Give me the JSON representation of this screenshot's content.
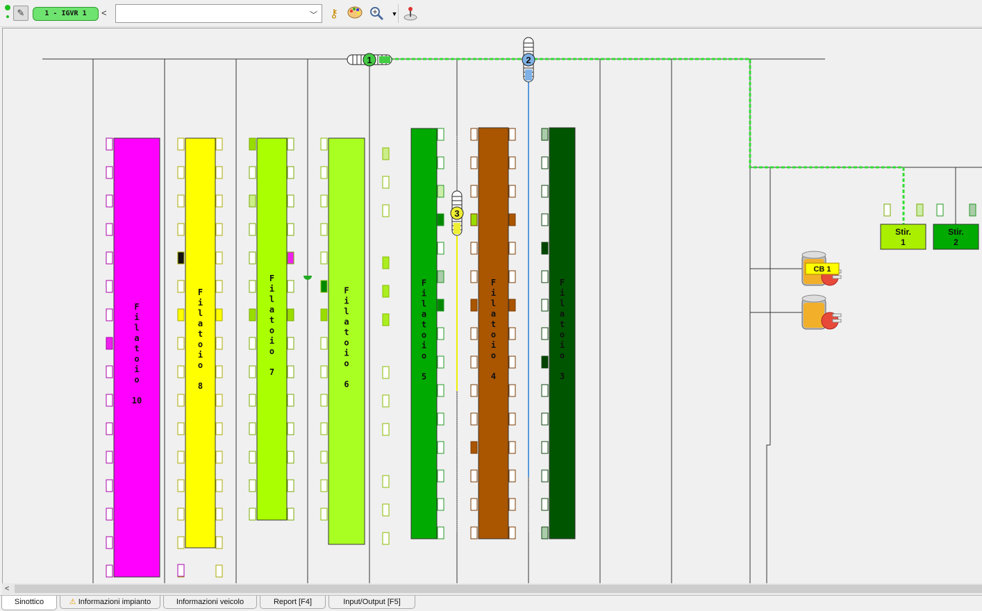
{
  "toolbar": {
    "vehicle_selector": "1 - IGVR 1",
    "prev_arrow": "<",
    "combo_value": "",
    "icons": [
      "status-led",
      "tools-icon",
      "key-icon",
      "palette-icon",
      "zoom-icon",
      "joystick-icon"
    ]
  },
  "synoptic": {
    "machines": [
      {
        "name": "Filatoio 10",
        "letters": "Filatoio",
        "number": "10",
        "color": "#ff00ff"
      },
      {
        "name": "Filatoio 8",
        "letters": "Filatoio",
        "number": "8",
        "color": "#ffff00"
      },
      {
        "name": "Filatoio 7",
        "letters": "Filatoio",
        "number": "7",
        "color": "#aaff00"
      },
      {
        "name": "Filatoio 6",
        "letters": "Filatoio",
        "number": "6",
        "color": "#aaff22"
      },
      {
        "name": "Filatoio 5",
        "letters": "Filatoio",
        "number": "5",
        "color": "#00aa00"
      },
      {
        "name": "Filatoio 4",
        "letters": "Filatoio",
        "number": "4",
        "color": "#aa5500"
      },
      {
        "name": "Filatoio 3",
        "letters": "Filatoio",
        "number": "3",
        "color": "#005500"
      }
    ],
    "stirs": [
      {
        "label": "Stir.",
        "number": "1",
        "color": "#aaee00"
      },
      {
        "label": "Stir.",
        "number": "2",
        "color": "#00aa00"
      }
    ],
    "vehicles": [
      {
        "id": "1",
        "color": "#44cc44"
      },
      {
        "id": "2",
        "color": "#7fb1e6"
      },
      {
        "id": "3",
        "color": "#eeee33"
      }
    ],
    "chargers": [
      {
        "label": "CB 1"
      },
      {
        "label": ""
      }
    ]
  },
  "tabs": [
    {
      "label": "Sinottico",
      "warning": false
    },
    {
      "label": "Informazioni impianto",
      "warning": true
    },
    {
      "label": "Informazioni veicolo",
      "warning": false
    },
    {
      "label": "Report [F4]",
      "warning": false
    },
    {
      "label": "Input/Output [F5]",
      "warning": false
    }
  ],
  "scroll_left": "<",
  "warning_glyph": "⚠"
}
